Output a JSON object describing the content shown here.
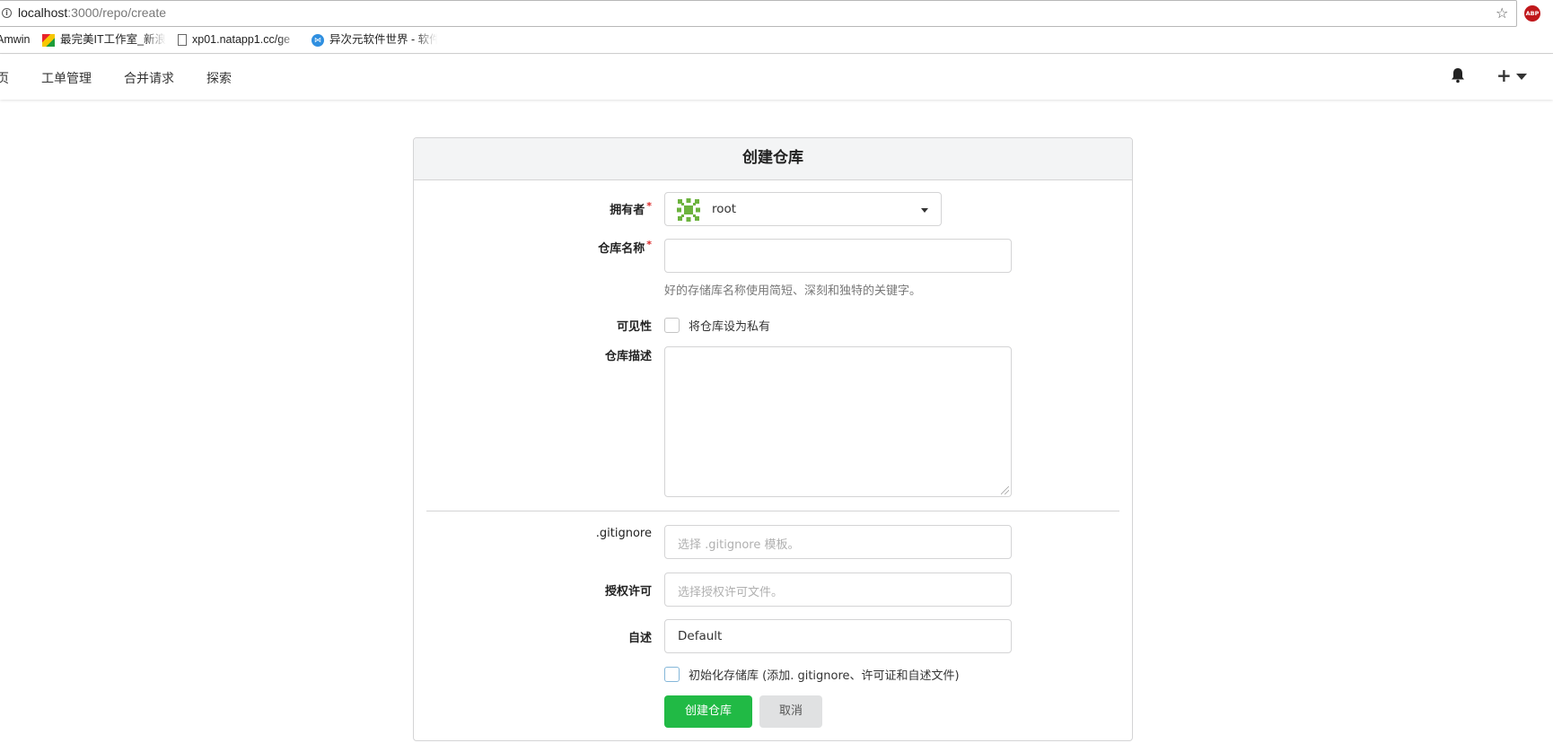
{
  "browser": {
    "url_host": "localhost",
    "url_path": ":3000/repo/create",
    "abp_label": "ABP",
    "bookmarks": [
      {
        "label": "Amwin",
        "icon": "none"
      },
      {
        "label": "最完美IT工作室_新浪",
        "icon": "colorful-flag-icon"
      },
      {
        "label": "xp01.natapp1.cc/ge",
        "icon": "page-icon"
      },
      {
        "label": "异次元软件世界 - 软件",
        "icon": "vs-icon"
      }
    ]
  },
  "navbar": {
    "items": [
      "首页",
      "工单管理",
      "合并请求",
      "探索"
    ]
  },
  "form": {
    "title": "创建仓库",
    "owner": {
      "label": "拥有者",
      "required_mark": "*",
      "value": "root"
    },
    "repo_name": {
      "label": "仓库名称",
      "required_mark": "*",
      "value": "",
      "help": "好的存储库名称使用简短、深刻和独特的关键字。"
    },
    "visibility": {
      "label": "可见性",
      "checkbox_label": "将仓库设为私有",
      "checked": false
    },
    "description": {
      "label": "仓库描述",
      "value": ""
    },
    "gitignore": {
      "label": ".gitignore",
      "placeholder": "选择 .gitignore 模板。"
    },
    "license": {
      "label": "授权许可",
      "placeholder": "选择授权许可文件。"
    },
    "readme": {
      "label": "自述",
      "value": "Default"
    },
    "auto_init": {
      "label": "初始化存储库 (添加. gitignore、许可证和自述文件)",
      "checked": false
    },
    "buttons": {
      "create": "创建仓库",
      "cancel": "取消"
    }
  },
  "colors": {
    "create_button": "#21ba45",
    "required": "#db2828",
    "abp": "#c0181c"
  }
}
